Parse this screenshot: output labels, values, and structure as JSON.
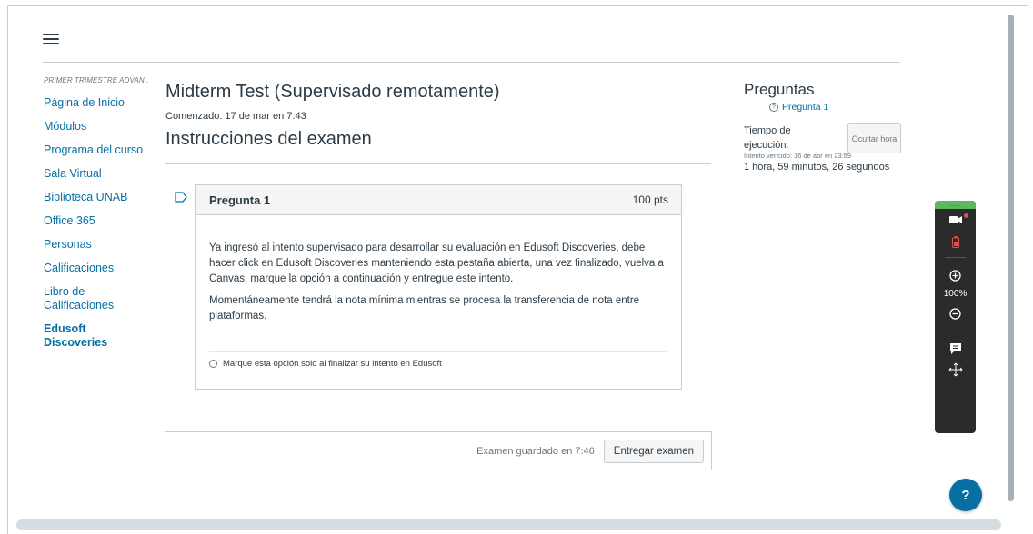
{
  "course_nav": {
    "course_title": "PRIMER TRIMESTRE ADVAN...",
    "items": [
      {
        "label": "Página de Inicio"
      },
      {
        "label": "Módulos"
      },
      {
        "label": "Programa del curso"
      },
      {
        "label": "Sala Virtual"
      },
      {
        "label": "Biblioteca UNAB"
      },
      {
        "label": "Office 365"
      },
      {
        "label": "Personas"
      },
      {
        "label": "Calificaciones"
      },
      {
        "label": "Libro de Calificaciones"
      },
      {
        "label": "Edusoft Discoveries"
      }
    ]
  },
  "quiz": {
    "title": "Midterm Test (Supervisado remotamente)",
    "started": "Comenzado: 17 de mar en 7:43",
    "instructions_title": "Instrucciones del examen"
  },
  "question": {
    "name": "Pregunta 1",
    "points": "100 pts",
    "paragraph1": "Ya ingresó al intento supervisado para desarrollar su evaluación en Edusoft Discoveries, debe hacer click en Edusoft Discoveries manteniendo esta pestaña abierta, una vez finalizado, vuelva a Canvas, marque la opción a continuación y entregue este intento.",
    "paragraph2": "Momentáneamente tendrá la nota mínima mientras se procesa la transferencia de nota entre plataformas.",
    "answer_option": "Marque esta opción solo al finalizar su intento en Edusoft"
  },
  "submit_bar": {
    "saved_text": "Examen guardado en 7:46",
    "submit_label": "Entregar examen"
  },
  "right_panel": {
    "title": "Preguntas",
    "question_link": "Pregunta 1",
    "time_label": "Tiempo de ejecución:",
    "hide_button": "Ocultar hora",
    "due_text": "Intento vencido: 16 de abr en 23:59",
    "remaining": "1 hora, 59 minutos, 26 segundos"
  },
  "proctor_toolbar": {
    "zoom": "100%",
    "grip": "::::"
  },
  "help_button": {
    "label": "?"
  },
  "colors": {
    "link": "#0770a3",
    "text": "#2d3b45",
    "border": "#c7cdd1",
    "toolbar_bg": "#2b2b2b",
    "toolbar_accent": "#5cb85c"
  }
}
